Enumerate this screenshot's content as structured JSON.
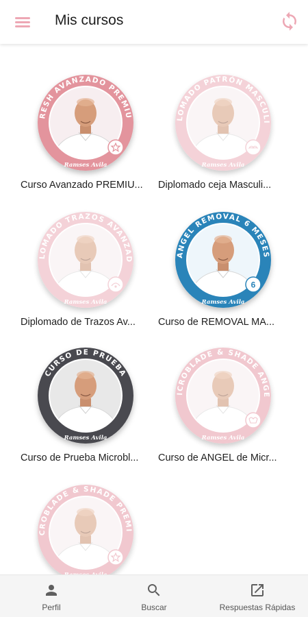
{
  "header": {
    "title": "Mis cursos",
    "menu_icon": "menu-icon",
    "sync_icon": "sync-icon",
    "accent_color": "#eda7b4"
  },
  "courses": [
    {
      "title": "Curso Avanzado PREMIU...",
      "badge_text": "MRESH AVANZADO PREMIUM",
      "instructor": "Ramses Avila",
      "ring_color": "#e3949d",
      "icon": "star-icon",
      "active": true
    },
    {
      "title": "Diplomado ceja Masculi...",
      "badge_text": "DIPLOMADO PATRÓN MASCULINO",
      "instructor": "Ramses Avila",
      "ring_color": "#f2c9d0",
      "icon": "mustache-icon",
      "active": false
    },
    {
      "title": "Diplomado de Trazos Av...",
      "badge_text": "DIPLOMADO TRAZOS AVANZADOS",
      "instructor": "Ramses Avila",
      "ring_color": "#f2c9d0",
      "icon": "brow-icon",
      "active": false
    },
    {
      "title": "Curso de REMOVAL MA...",
      "badge_text": "ANGEL REMOVAL 6 MESES",
      "instructor": "Ramses Avila",
      "ring_color": "#2a84b9",
      "icon": "number-six-icon",
      "active": true
    },
    {
      "title": "Curso de Prueba Microbl...",
      "badge_text": "CURSO DE PRUEBA",
      "instructor": "Ramses Avila",
      "ring_color": "#4a4a50",
      "icon": "none",
      "active": true
    },
    {
      "title": "Curso de ANGEL de Micr...",
      "badge_text": "MICROBLADE & SHADE ANGEL",
      "instructor": "Ramses Avila",
      "ring_color": "#efbcc5",
      "icon": "angel-icon",
      "active": false
    },
    {
      "title": "",
      "badge_text": "MICROBLADE & SHADE PREMIUM",
      "instructor": "Ramses Avila",
      "ring_color": "#efbcc5",
      "icon": "star-icon",
      "active": false
    }
  ],
  "bottom_nav": [
    {
      "label": "Perfil",
      "icon": "person-icon"
    },
    {
      "label": "Buscar",
      "icon": "search-icon"
    },
    {
      "label": "Respuestas Rápidas",
      "icon": "open-in-new-icon"
    }
  ]
}
